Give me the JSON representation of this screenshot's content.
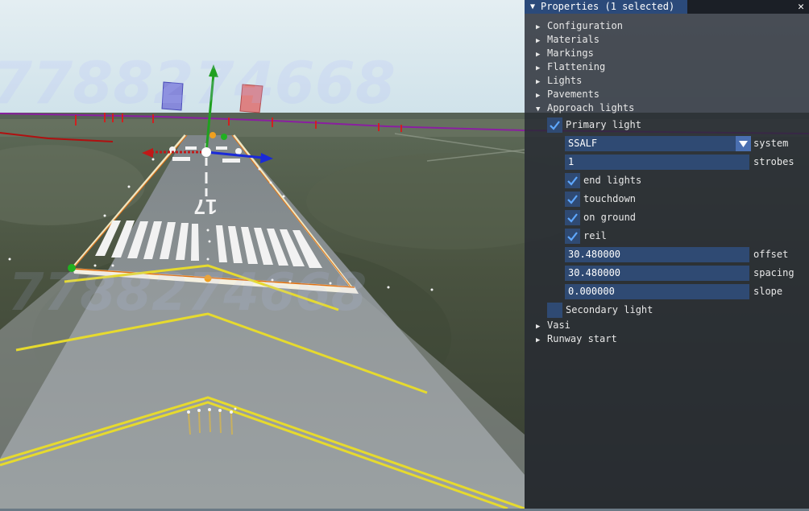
{
  "viewport": {
    "watermark_top": "7788274668",
    "watermark_bottom": "7788274668",
    "runway_number": "17",
    "colors": {
      "sky": "#dce8ec",
      "ground": "#4b5440",
      "runway": "#8d9496",
      "yellow_marking": "#e6da2e"
    },
    "gizmo_icons": [
      "move-y-arrow-icon",
      "move-x-arrow-icon",
      "move-z-arrow-icon",
      "plane-handle-icon"
    ]
  },
  "properties": {
    "title": "Properties (1 selected)",
    "collapse_icon": "triangle-down-icon",
    "close_icon": "close-icon",
    "sections": [
      "Configuration",
      "Materials",
      "Markings",
      "Flattening",
      "Lights",
      "Pavements"
    ],
    "approach_lights": {
      "label": "Approach lights",
      "primary_light": {
        "label": "Primary light",
        "checked": true
      },
      "system": {
        "value": "SSALF",
        "label": "system"
      },
      "strobes": {
        "value": "1",
        "label": "strobes"
      },
      "toggles": [
        {
          "label": "end lights",
          "checked": true
        },
        {
          "label": "touchdown",
          "checked": true
        },
        {
          "label": "on ground",
          "checked": true
        },
        {
          "label": "reil",
          "checked": true
        }
      ],
      "offset": {
        "value": "30.480000",
        "label": "offset"
      },
      "spacing": {
        "value": "30.480000",
        "label": "spacing"
      },
      "slope": {
        "value": "0.000000",
        "label": "slope"
      },
      "secondary_light": {
        "label": "Secondary light",
        "checked": false
      }
    },
    "after_sections": [
      "Vasi",
      "Runway start"
    ]
  }
}
